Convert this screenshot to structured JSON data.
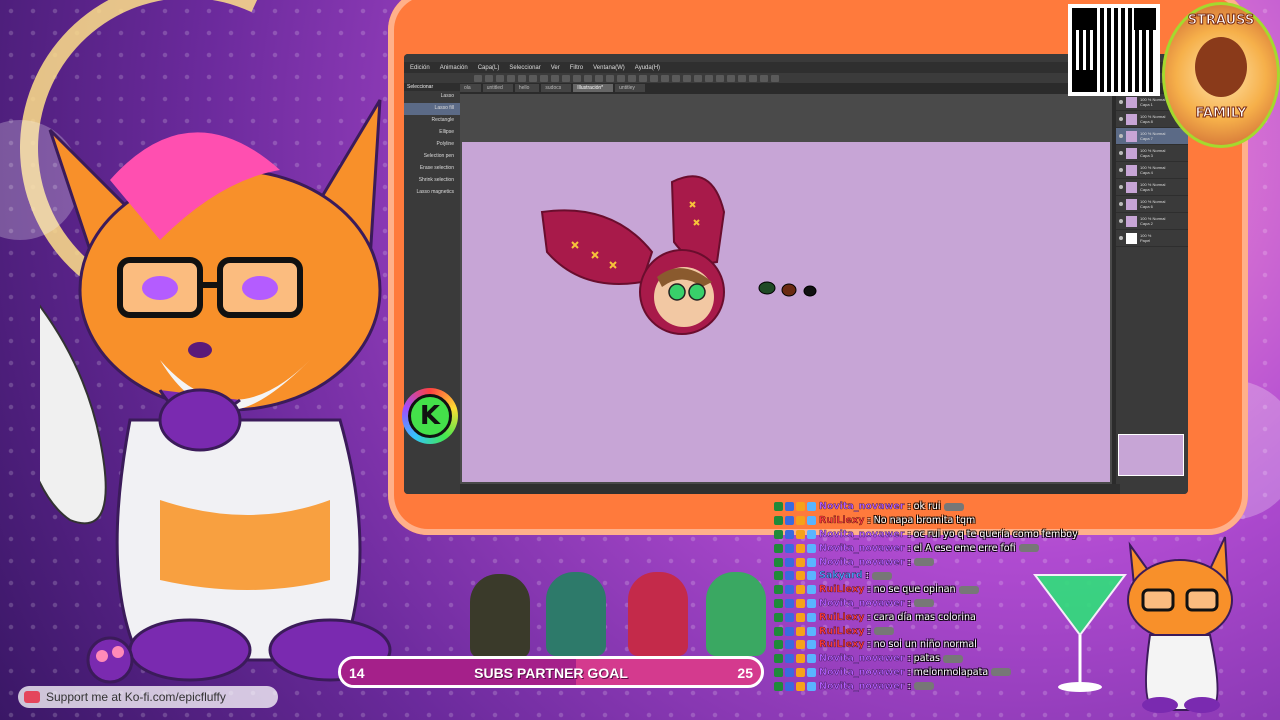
{
  "app": {
    "menu": [
      "Edición",
      "Animación",
      "Capa(L)",
      "Seleccionar",
      "Ver",
      "Filtro",
      "Ventana(W)",
      "Ayuda(H)"
    ],
    "doc_tabs": [
      "ola",
      "untitled",
      "hello",
      "sudocs",
      "Illustración*",
      "untitley"
    ],
    "active_tab_index": 4,
    "subtools_header": "Seleccionar",
    "subtools": [
      "Lasso",
      "Lasso fill",
      "Rectangle",
      "Ellipse",
      "Polyline",
      "Selection pen",
      "Erase selection",
      "Shrink selection",
      "Lasso magnetics"
    ],
    "active_subtool_index": 1,
    "layers": [
      {
        "opacity": "100 % Normal",
        "name": "Capa 1"
      },
      {
        "opacity": "100 % Normal",
        "name": "Capa 8"
      },
      {
        "opacity": "100 % Normal",
        "name": "Capa 7"
      },
      {
        "opacity": "100 % Normal",
        "name": "Capa 3"
      },
      {
        "opacity": "100 % Normal",
        "name": "Capa 4"
      },
      {
        "opacity": "100 % Normal",
        "name": "Capa 5"
      },
      {
        "opacity": "100 % Normal",
        "name": "Capa 6"
      },
      {
        "opacity": "100 % Normal",
        "name": "Capa 2"
      },
      {
        "opacity": "100 %",
        "name": "Papel"
      }
    ],
    "active_layer_index": 2
  },
  "badge": {
    "top": "STRAUSS",
    "bottom": "FAMILY"
  },
  "chat": [
    {
      "user": "Novita_novawer",
      "user_color": "#b45cff",
      "msg": ": ok rui",
      "emote": true
    },
    {
      "user": "RuiLlexy",
      "user_color": "#ff3a3a",
      "msg": ": No napa bromita tqm",
      "emote": false
    },
    {
      "user": "Novita_novawer",
      "user_color": "#b45cff",
      "msg": ": oc rui yo q te quería como femboy",
      "emote": false
    },
    {
      "user": "Novita_novawer",
      "user_color": "#b45cff",
      "msg": ": el A ese eme erre fofi",
      "emote": true
    },
    {
      "user": "Novita_novawer",
      "user_color": "#b45cff",
      "msg": ":",
      "emote": true
    },
    {
      "user": "Sakyard",
      "user_color": "#4fa0ff",
      "msg": ":",
      "emote": true
    },
    {
      "user": "RuiLlexy",
      "user_color": "#ff3a3a",
      "msg": ": no se que opinan",
      "emote": true
    },
    {
      "user": "Novita_novawer",
      "user_color": "#b45cff",
      "msg": ":",
      "emote": true
    },
    {
      "user": "RuiLlexy",
      "user_color": "#ff3a3a",
      "msg": ": cara día mas colorina",
      "emote": false
    },
    {
      "user": "RuiLlexy",
      "user_color": "#ff3a3a",
      "msg": ":",
      "emote": true
    },
    {
      "user": "RuiLlexy",
      "user_color": "#ff3a3a",
      "msg": ": no soi un niño normal",
      "emote": false
    },
    {
      "user": "Novita_novawer",
      "user_color": "#b45cff",
      "msg": ": patas",
      "emote": true
    },
    {
      "user": "Novita_novawer",
      "user_color": "#b45cff",
      "msg": ": melonmolapata",
      "emote": true
    },
    {
      "user": "Novita_novawer",
      "user_color": "#b45cff",
      "msg": ":",
      "emote": true
    }
  ],
  "goal": {
    "label": "SUBS PARTNER GOAL",
    "current": "14",
    "target": "25",
    "progress_fraction": 0.56
  },
  "kofi": {
    "text": "Support me at Ko-fi.com/epicfluffy"
  },
  "k_logo": "K",
  "colors": {
    "frame": "#ff7a3c",
    "canvas": "#c7a5d6",
    "goal_bar": "#d43a8e",
    "accent_purple": "#7a2ab0"
  }
}
